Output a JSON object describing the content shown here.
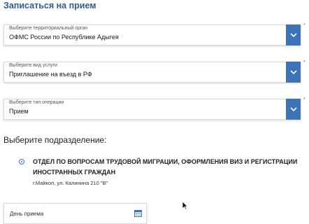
{
  "page": {
    "title": "Записаться на прием"
  },
  "fields": [
    {
      "label": "Выберите территориальный орган",
      "value": "ОФМС России по Республике Адыгея",
      "required_mark": "*"
    },
    {
      "label": "Выберите вид услуги",
      "value": "Приглашение на въезд в РФ",
      "required_mark": "*"
    },
    {
      "label": "Выберите тип операции",
      "value": "Прием",
      "required_mark": "*"
    }
  ],
  "subdivision": {
    "heading": "Выберите подразделение:",
    "option": {
      "name": "ОТДЕЛ ПО ВОПРОСАМ ТРУДОВОЙ МИГРАЦИИ, ОФОРМЛЕНИЯ ВИЗ И РЕГИСТРАЦИИ ИНОСТРАННЫХ ГРАЖДАН",
      "address": "г.Майкоп, ул. Калинина 210 \"В\"",
      "selected": true
    }
  },
  "date_field": {
    "label": "День приема",
    "icon": "calendar-icon"
  },
  "colors": {
    "title": "#2e5c8f",
    "accent": "#3d74b8"
  }
}
